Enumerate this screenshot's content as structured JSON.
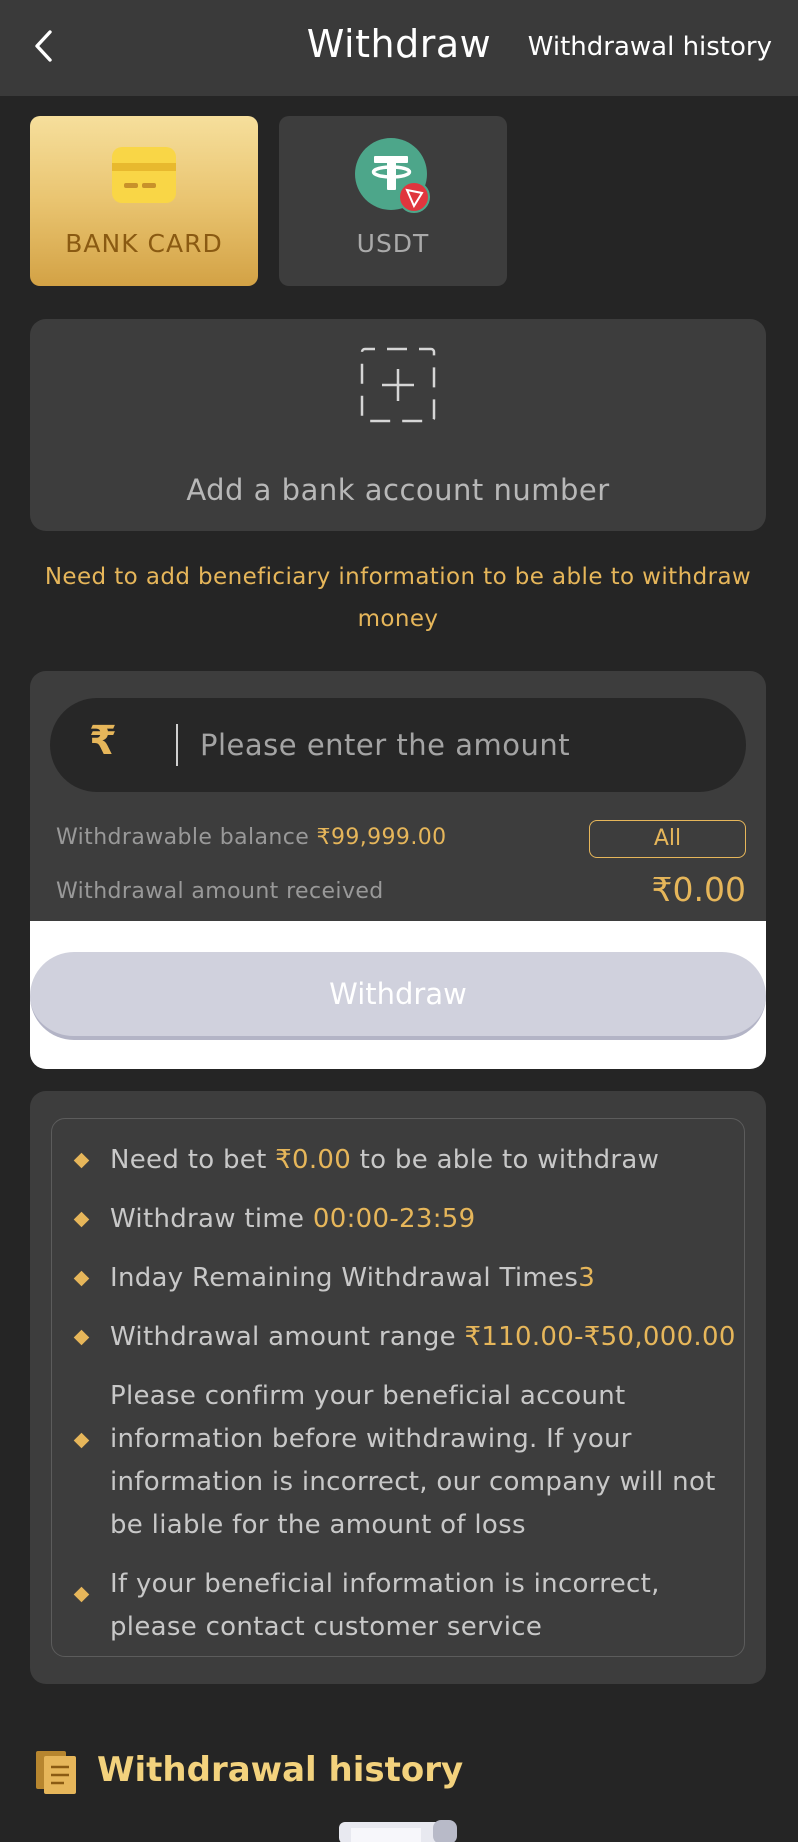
{
  "header": {
    "title": "Withdraw",
    "history_link": "Withdrawal history",
    "back_icon": "chevron-left-icon"
  },
  "tabs": [
    {
      "label": "BANK CARD",
      "icon": "bank-card-icon",
      "selected": true
    },
    {
      "label": "USDT",
      "icon": "usdt-tron-icon",
      "selected": false
    }
  ],
  "bank": {
    "add_label": "Add a bank account number",
    "notice": "Need to add beneficiary information to be able to withdraw money"
  },
  "amount": {
    "currency_symbol": "₹",
    "placeholder": "Please enter the amount",
    "value": "",
    "balance_label": "Withdrawable balance",
    "balance_value": "₹99,999.00",
    "all_label": "All",
    "received_label": "Withdrawal amount received",
    "received_value": "₹0.00"
  },
  "withdraw_button": "Withdraw",
  "rules": {
    "bet_prefix": "Need to bet ",
    "bet_value": "₹0.00",
    "bet_suffix": " to be able to withdraw",
    "time_prefix": "Withdraw time ",
    "time_value": "00:00-23:59",
    "times_prefix": "Inday Remaining Withdrawal Times",
    "times_value": "3",
    "range_prefix": "Withdrawal amount range ",
    "range_value": "₹110.00-₹50,000.00",
    "confirm_text": "Please confirm your beneficial account information before withdrawing. If your information is incorrect, our company will not be liable for the amount of loss",
    "contact_text": "If your beneficial information is incorrect, please contact customer service"
  },
  "history": {
    "title": "Withdrawal history",
    "icon": "document-list-icon"
  },
  "colors": {
    "background": "#252525",
    "panel": "#3d3d3d",
    "accent_gold": "#e6b65a",
    "button_disabled": "#d0d1dd"
  }
}
